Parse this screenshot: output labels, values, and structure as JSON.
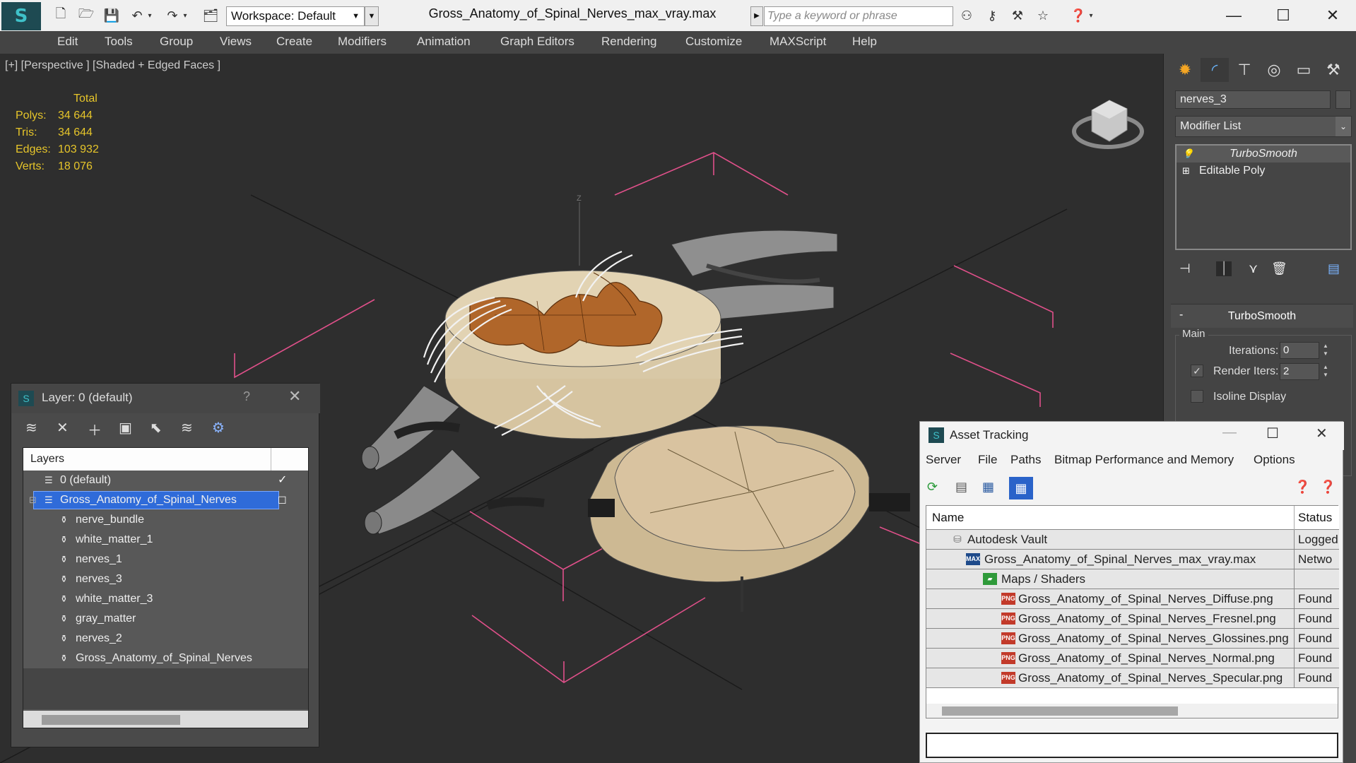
{
  "titlebar": {
    "workspace_label": "Workspace: Default",
    "doc_title": "Gross_Anatomy_of_Spinal_Nerves_max_vray.max",
    "search_placeholder": "Type a keyword or phrase"
  },
  "menu": [
    "Edit",
    "Tools",
    "Group",
    "Views",
    "Create",
    "Modifiers",
    "Animation",
    "Graph Editors",
    "Rendering",
    "Customize",
    "MAXScript",
    "Help"
  ],
  "viewport": {
    "label": "[+] [Perspective ] [Shaded + Edged Faces ]",
    "stats_header": "Total",
    "stats": [
      {
        "key": "Polys:",
        "value": "34 644"
      },
      {
        "key": "Tris:",
        "value": "34 644"
      },
      {
        "key": "Edges:",
        "value": "103 932"
      },
      {
        "key": "Verts:",
        "value": "18 076"
      }
    ],
    "axis_label": "Z"
  },
  "command_panel": {
    "object_name": "nerves_3",
    "modifier_list": "Modifier List",
    "stack": [
      "TurboSmooth",
      "Editable Poly"
    ],
    "rollout_title": "TurboSmooth",
    "group_main": "Main",
    "iterations_label": "Iterations:",
    "iterations_value": "0",
    "render_iters_label": "Render Iters:",
    "render_iters_value": "2",
    "render_iters_checked": true,
    "isoline_label": "Isoline Display"
  },
  "layer_window": {
    "title": "Layer: 0 (default)",
    "help": "?",
    "column_header": "Layers",
    "rows": [
      {
        "label": "0 (default)",
        "level": 0,
        "selected": false
      },
      {
        "label": "Gross_Anatomy_of_Spinal_Nerves",
        "level": 0,
        "selected": true
      },
      {
        "label": "nerve_bundle",
        "level": 1,
        "selected": false
      },
      {
        "label": "white_matter_1",
        "level": 1,
        "selected": false
      },
      {
        "label": "nerves_1",
        "level": 1,
        "selected": false
      },
      {
        "label": "nerves_3",
        "level": 1,
        "selected": false
      },
      {
        "label": "white_matter_3",
        "level": 1,
        "selected": false
      },
      {
        "label": "gray_matter",
        "level": 1,
        "selected": false
      },
      {
        "label": "nerves_2",
        "level": 1,
        "selected": false
      },
      {
        "label": "Gross_Anatomy_of_Spinal_Nerves",
        "level": 1,
        "selected": false
      }
    ]
  },
  "asset_window": {
    "title": "Asset Tracking",
    "menu": [
      "Server",
      "File",
      "Paths",
      "Bitmap Performance and Memory",
      "Options"
    ],
    "col_name": "Name",
    "col_status": "Status",
    "rows": [
      {
        "name": "Autodesk Vault",
        "status": "Logged",
        "icon": "vault-icon"
      },
      {
        "name": "Gross_Anatomy_of_Spinal_Nerves_max_vray.max",
        "status": "Netwo",
        "icon": "max-file-icon"
      },
      {
        "name": "Maps / Shaders",
        "status": "",
        "icon": "maps-icon"
      },
      {
        "name": "Gross_Anatomy_of_Spinal_Nerves_Diffuse.png",
        "status": "Found",
        "icon": "png-icon"
      },
      {
        "name": "Gross_Anatomy_of_Spinal_Nerves_Fresnel.png",
        "status": "Found",
        "icon": "png-icon"
      },
      {
        "name": "Gross_Anatomy_of_Spinal_Nerves_Glossines.png",
        "status": "Found",
        "icon": "png-icon"
      },
      {
        "name": "Gross_Anatomy_of_Spinal_Nerves_Normal.png",
        "status": "Found",
        "icon": "png-icon"
      },
      {
        "name": "Gross_Anatomy_of_Spinal_Nerves_Specular.png",
        "status": "Found",
        "icon": "png-icon"
      }
    ]
  },
  "colors": {
    "stats_yellow": "#e6c52a",
    "selection_blue": "#2f6bd9",
    "gizmo_pink": "#e0508a",
    "white_matter": "#d8c8a8",
    "gray_matter": "#b0662a"
  }
}
